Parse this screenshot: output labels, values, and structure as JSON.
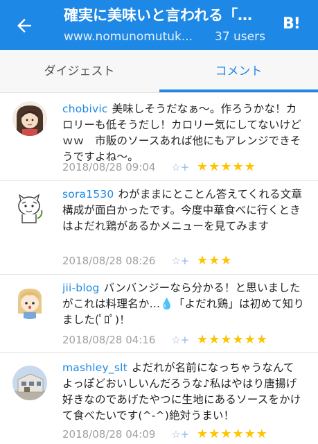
{
  "appbar": {
    "title": "確実に美味いと言われる「…",
    "url": "www.nomunomutuk...",
    "users": "37 users",
    "logo": "B!"
  },
  "tabs": [
    {
      "label": "ダイジェスト"
    },
    {
      "label": "コメント"
    }
  ],
  "comments": [
    {
      "user": "chobivic",
      "text": "美味しそうだなぁ〜。作ろうかな！カロリーも低そうだし！カロリー気にしてないけどｗｗ　市販のソースあれば他にもアレンジできそうですよね〜。",
      "date": "2018/08/28 09:04",
      "star_icon": "☆+",
      "stars": "★★★★★"
    },
    {
      "user": "sora1530",
      "text": "わがままにとことん答えてくれる文章構成が面白かったです。今度中華食べに行くときはよだれ鶏があるかメニューを見てみます",
      "date": "2018/08/28 08:26",
      "star_icon": "☆+",
      "stars": "★★★"
    },
    {
      "user": "jii-blog",
      "text": "バンバンジーなら分かる！と思いましたがこれは料理名か…💧「よだれ鶏」は初めて知りました(ﾟﾛﾟ)！",
      "date": "2018/08/28 04:16",
      "star_icon": "☆+",
      "stars": "★★★★★★"
    },
    {
      "user": "mashley_slt",
      "text": "よだれが名前になっちゃうなんてよっぽどおいしいんだろうな♪私はやはり唐揚げ好きなのであげたやつに生地にあるソースをかけて食べたいです(^-^)絶対うまい！",
      "date": "2018/08/28 04:09",
      "star_icon": "☆+",
      "stars": "★★★★★★"
    }
  ],
  "colors": {
    "primary": "#1d88e5",
    "star": "#ffc400",
    "meta": "#a0a0a0"
  }
}
